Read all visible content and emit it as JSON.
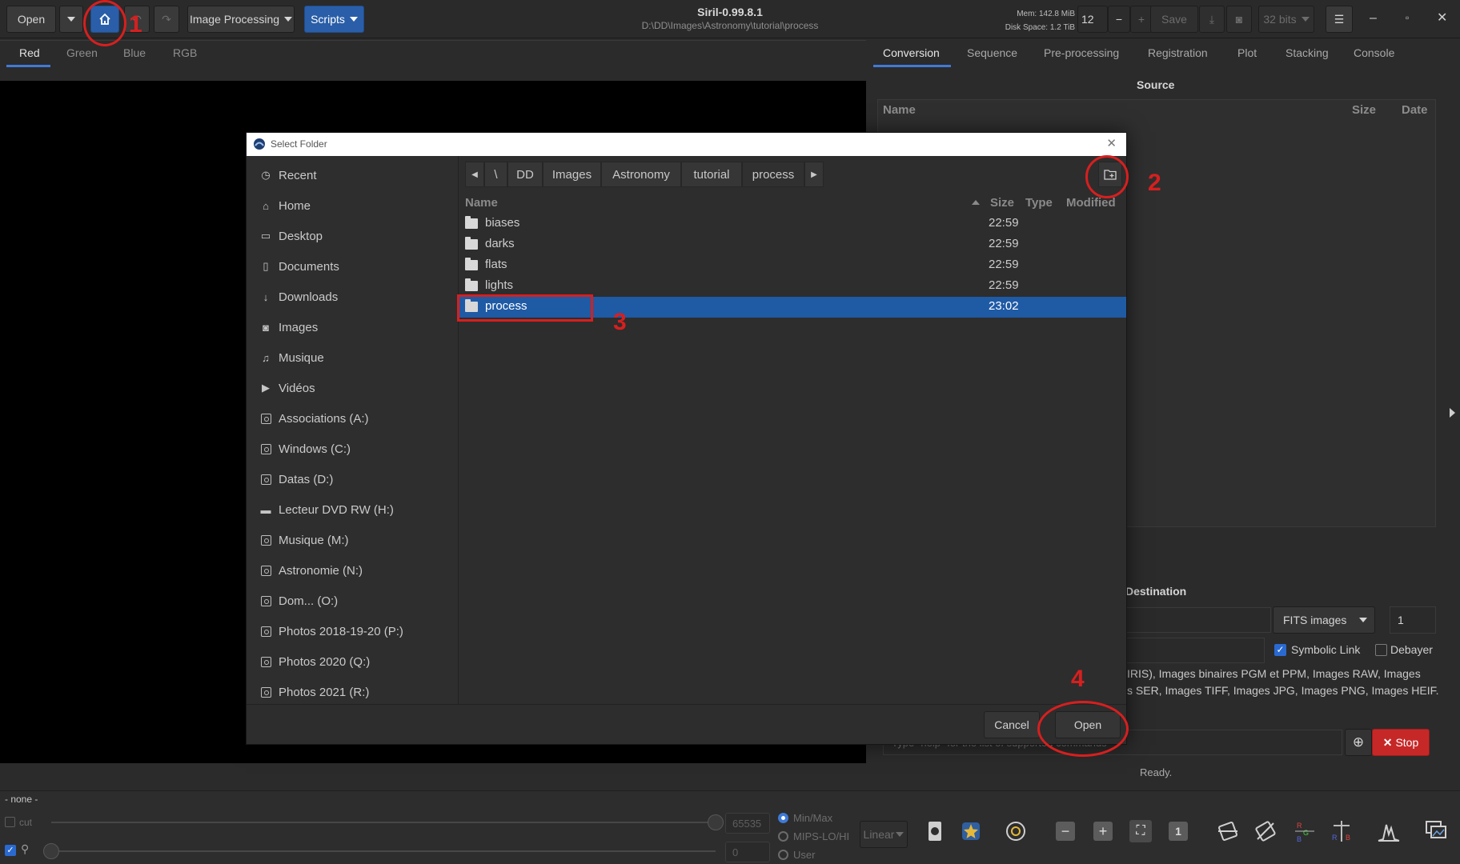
{
  "app": {
    "title": "Siril-0.99.8.1",
    "path": "D:\\DD\\Images\\Astronomy\\tutorial\\process",
    "mem": "Mem: 142.8 MiB",
    "disk": "Disk Space: 1.2 TiB"
  },
  "toolbar": {
    "open_label": "Open",
    "image_processing_label": "Image Processing",
    "scripts_label": "Scripts",
    "threads_value": "12",
    "save_label": "Save",
    "bits_label": "32 bits"
  },
  "channel_tabs": [
    "Red",
    "Green",
    "Blue",
    "RGB"
  ],
  "right_tabs": [
    "Conversion",
    "Sequence",
    "Pre-processing",
    "Registration",
    "Plot",
    "Stacking",
    "Console"
  ],
  "conversion": {
    "source_label": "Source",
    "col_name": "Name",
    "col_size": "Size",
    "col_date": "Date",
    "destination_label": "Destination",
    "format_value": "FITS images",
    "index_value": "1",
    "symbolic_link_label": "Symbolic Link",
    "debayer_label": "Debayer",
    "supported_text_1": "IRIS), Images binaires PGM et PPM, Images RAW, Images",
    "supported_text_2": "s SER, Images TIFF, Images JPG, Images PNG, Images HEIF.",
    "command_placeholder": "Type \"help\" for the list of supported commands",
    "stop_label": "Stop",
    "status": "Ready."
  },
  "bottom": {
    "seq_name": "- none -",
    "cut_label": "cut",
    "high_value": "65535",
    "low_value": "0",
    "modes": [
      "Min/Max",
      "MIPS-LO/HI",
      "User"
    ],
    "scale_label": "Linear",
    "zoom_one_label": "1"
  },
  "dialog": {
    "title": "Select Folder",
    "places": [
      "Recent",
      "Home",
      "Desktop",
      "Documents",
      "Downloads",
      "Images",
      "Musique",
      "Vidéos",
      "Associations (A:)",
      "Windows (C:)",
      "Datas (D:)",
      "Lecteur DVD RW (H:)",
      "Musique (M:)",
      "Astronomie (N:)",
      "Dom... (O:)",
      "Photos 2018-19-20 (P:)",
      "Photos 2020 (Q:)",
      "Photos 2021 (R:)"
    ],
    "breadcrumb": [
      "\\",
      "DD",
      "Images",
      "Astronomy",
      "tutorial",
      "process"
    ],
    "columns": {
      "name": "Name",
      "size": "Size",
      "type": "Type",
      "modified": "Modified"
    },
    "files": [
      {
        "name": "biases",
        "modified": "22:59"
      },
      {
        "name": "darks",
        "modified": "22:59"
      },
      {
        "name": "flats",
        "modified": "22:59"
      },
      {
        "name": "lights",
        "modified": "22:59"
      },
      {
        "name": "process",
        "modified": "23:02"
      }
    ],
    "cancel_label": "Cancel",
    "open_label": "Open"
  },
  "annotations": [
    "1",
    "2",
    "3",
    "4"
  ],
  "colors": {
    "accent": "#2a5ea8",
    "selection": "#1f5aa5",
    "annotation": "#d71f1f",
    "stop": "#c62828"
  }
}
